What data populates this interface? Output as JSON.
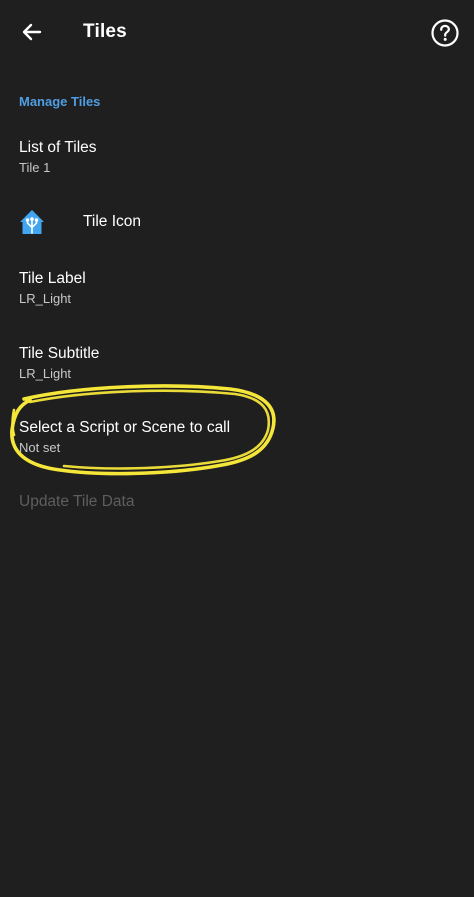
{
  "app_bar": {
    "title": "Tiles",
    "back_icon": "arrow-left-icon",
    "help_icon": "help-circle-icon"
  },
  "section": {
    "header": "Manage Tiles"
  },
  "prefs": {
    "list_of_tiles": {
      "title": "List of Tiles",
      "summary": "Tile 1"
    },
    "tile_icon": {
      "title": "Tile Icon",
      "icon": "home-assistant-icon"
    },
    "tile_label": {
      "title": "Tile Label",
      "summary": "LR_Light"
    },
    "tile_subtitle": {
      "title": "Tile Subtitle",
      "summary": "LR_Light"
    },
    "script_scene": {
      "title": "Select a Script or Scene to call",
      "summary": "Not set"
    },
    "update": {
      "title": "Update Tile Data"
    }
  },
  "colors": {
    "background": "#1f1f1f",
    "accent": "#4f9ee3",
    "highlight": "#f5e63a",
    "disabled_text": "#5e5e5e"
  }
}
